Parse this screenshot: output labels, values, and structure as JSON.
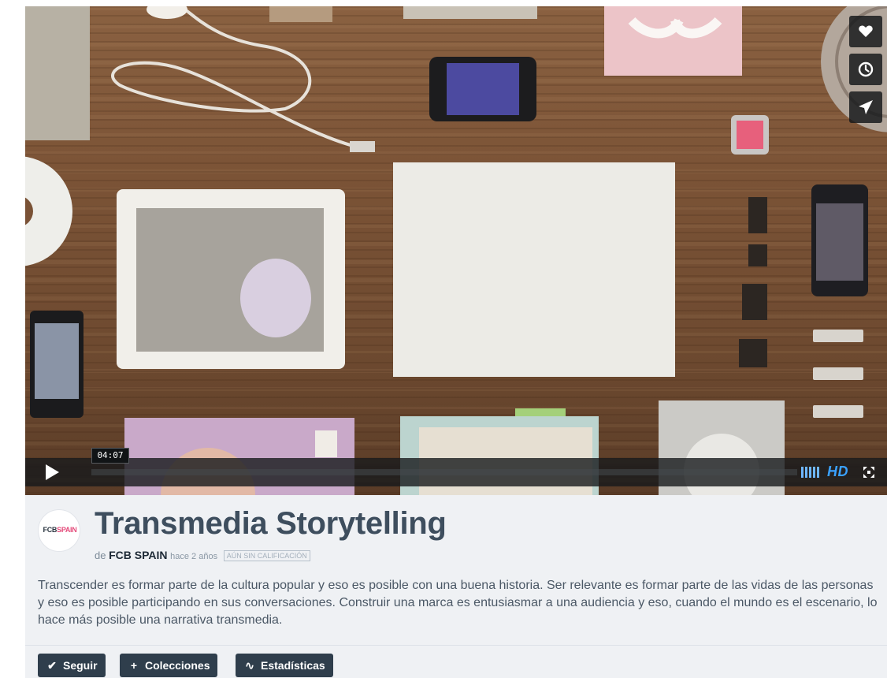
{
  "player": {
    "time_tooltip": "04:07",
    "hd_label": "HD",
    "icons": {
      "like": "heart-icon",
      "watch_later": "clock-icon",
      "share": "paper-plane-icon",
      "play": "play-icon",
      "volume": "volume-bars-icon",
      "fullscreen": "fullscreen-icon"
    }
  },
  "video": {
    "channel_logo_text_dark": "FCB",
    "channel_logo_text_pink": "SPAIN",
    "title": "Transmedia Storytelling",
    "by_prefix": "de",
    "author": "FCB SPAIN",
    "posted_ago": "hace 2 años",
    "rating_badge": "AÚN SIN CALIFICACIÓN",
    "description": "Transcender es formar parte de la cultura popular y eso es posible con una buena historia. Ser relevante es formar parte de las vidas de las personas y eso es posible participando en sus conversaciones. Construir una marca es entusiasmar a una audiencia y eso, cuando el mundo es el escenario, lo hace más posible una narrativa transmedia."
  },
  "actions": {
    "follow": {
      "icon": "checkmark-icon",
      "glyph": "✔",
      "label": "Seguir"
    },
    "collections": {
      "icon": "plus-icon",
      "glyph": "+",
      "label": "Colecciones"
    },
    "stats": {
      "icon": "stats-icon",
      "glyph": "∿",
      "label": "Estadísticas"
    }
  },
  "colors": {
    "title": "#3e4e5e",
    "button_bg": "#2f3e4c",
    "hd_accent": "#3aa1ff",
    "info_bg": "#eff1f4"
  }
}
